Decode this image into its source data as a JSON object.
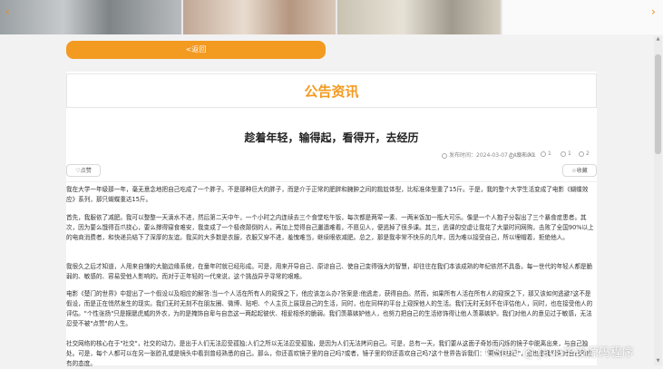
{
  "carousel": {
    "left_arrow": "‹",
    "right_arrow": "›"
  },
  "back_button": {
    "label": "<返回"
  },
  "section": {
    "title": "公告资讯"
  },
  "article": {
    "title": "趁着年轻，输得起，看得开，去经历",
    "meta": {
      "publish_time": "发布时间：2024-03-07 14:37:00",
      "publisher": "发布人1",
      "likes": "1",
      "favorites": "1",
      "comments": "2"
    },
    "like_label": "点赞",
    "collect_label": "收藏",
    "paragraphs": [
      "我在大学一年级那一年，毫无意念地把自己吃成了一个胖子。不是那种巨大的胖子，而是介于正常的肥胖和臃肿之间的尴尬体型，比标准体型重了15斤。于是，我的整个大学生活变成了电影《蝴蝶效应》系列，那只蝴蝶重达15斤。",
      "首先，我服依了减肥。我可以整整一天滴水不进，然后第二天中午，一个小时之内连续去三个食堂吃午饭，每次都是两荤一素、一两米饭加一瓶大可乐。像是一个人抱子分裂出了三个暴食症患者。其次，因为要么饿得百爪挠心，要么撑得寝食难安，我变成了一个极夜颠倒的人，再加上觉得自己邋遢难看，不愿见人，便逃掉了很多课。其三，逃课的空虚让我花了大量时间网购，击败了全国90%以上的电商消费者，和快递员结下了深厚的友谊。我买的大多数是衣服，衣服又穿不进，羞愧难当，继续眼依减肥。总之，那是我非常不快乐的几年，因为难以接受自己，所以埋帽着，拒绝他人。",
      "我很久之后才知道，人用来自慊的大脑边缘系统，在童年时就已经形成。可是，用来开导自己、原谅自己、使自己变得强大的智慧，却往往在我们本该成熟的年纪依然不具备。每一世代的年轻人都是脆弱的、敏感的、容易受他人影响的。而对于正年轻的一代来说，这个挑战异乎寻常的艰难。",
      "电影《楚门的世界》中提出了一个假设以及相应的解答:当一个人活在所有人的窥探之下，他应该怎么办?答案是:他逃走，获得自由。然而，如果所有人活在所有人的窥探之下，那又该如何逃避?这不是假设，而是正在悄然发生的现实。我们无时无刻不在朋友圈、微博、贴吧、个人主页上展现自己的生活，同时，也在同样的平台上窥探他人的生活。我们无时无刻不在评估他人，同时，也在接受他人的评估。\"个性张扬\"只是揠腮虎威的外衣，为的是掩饰自卑与自恋这一两起起彼伏、相爱相杀的脆弱。我们羡慕嫉妒他人，也努力把自己的生活修饰得让他人羡慕嫉妒。我们对他人的意见过于敏感，无法忍受不被\"点赞\"的人生。",
      "社交网络的核心在于\"社交\"，社交的动力，是出于人们无法忍受孤独;人们之所以无法忍受孤独，是因为人们无法拷问自己。可是，总有一天，我们要从这面子奇妙而闪烁的镜子中脱离出来，与自己独处。可是，每个人都可以在另一张脸孔或是镜头中看到曾经熟悉的自己。那么，你还喜欢镜子里的自己吗?或者，镜子里的你还喜欢自己吗?这个世界告诉我们：\"要做你自己\"，这也是我们面对自己所应有的态度。"
    ]
  },
  "watermark": "CSDN @  Java毕设源码程序"
}
